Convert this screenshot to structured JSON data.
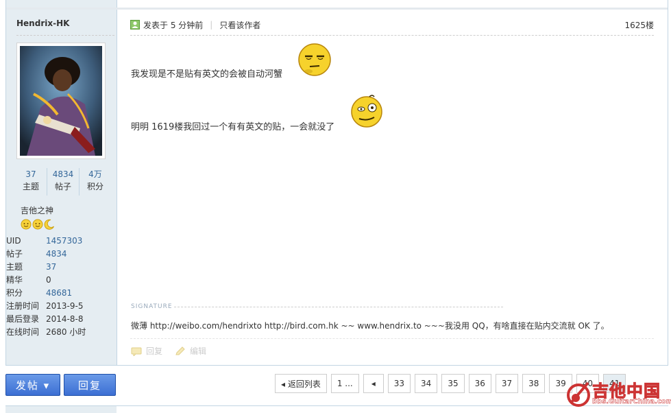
{
  "author": {
    "name": "Hendrix-HK",
    "stats": [
      {
        "value": "37",
        "label": "主题"
      },
      {
        "value": "4834",
        "label": "帖子"
      },
      {
        "value": "4万",
        "label": "积分"
      }
    ],
    "rank": "吉他之神",
    "info": [
      {
        "key": "UID",
        "value": "1457303",
        "link": true
      },
      {
        "key": "帖子",
        "value": "4834",
        "link": true
      },
      {
        "key": "主题",
        "value": "37",
        "link": true
      },
      {
        "key": "精华",
        "value": "0",
        "link": false
      },
      {
        "key": "积分",
        "value": "48681",
        "link": true
      },
      {
        "key": "注册时间",
        "value": "2013-9-5",
        "link": false
      },
      {
        "key": "最后登录",
        "value": "2014-8-8",
        "link": false
      },
      {
        "key": "在线时间",
        "value": "2680 小时",
        "link": false
      }
    ]
  },
  "post": {
    "posted": "发表于 5 分钟前",
    "author_only": "只看该作者",
    "floor": "1625楼",
    "line1": "我发现是不是贴有英文的会被自动河蟹",
    "line2": "明明 1619楼我回过一个有有英文的贴，一会就没了",
    "signature_title": "SIGNATURE",
    "signature": "微薄  http://weibo.com/hendrixto     http://bird.com.hk ~~ www.hendrix.to ~~~我没用 QQ，有啥直接在贴内交流就 OK 了。",
    "reply_label": "回复",
    "edit_label": "编辑"
  },
  "buttons": {
    "post": "发帖 ▾",
    "reply": "回复"
  },
  "pager": {
    "back": "◂ 返回列表",
    "first": "1 ...",
    "prev": "◂",
    "pages": [
      "33",
      "34",
      "35",
      "36",
      "37",
      "38",
      "39",
      "40",
      "41"
    ]
  },
  "watermark": {
    "title": "吉他中国",
    "site": "bbs.GuitarChina.com"
  },
  "colors": {
    "sidebar": "#e5edf2",
    "border": "#c2d5e3",
    "link": "#336699",
    "button": "#3c6fd3"
  }
}
